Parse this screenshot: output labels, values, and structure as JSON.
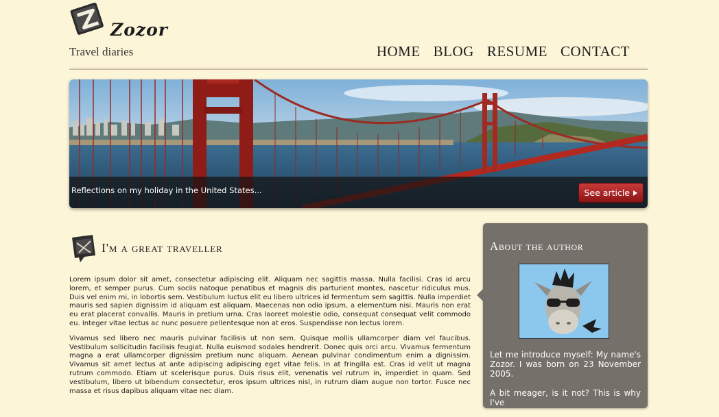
{
  "header": {
    "logo_text": "Zozor",
    "tagline": "Travel diaries",
    "nav": [
      {
        "label": "HOME"
      },
      {
        "label": "BLOG"
      },
      {
        "label": "RESUME"
      },
      {
        "label": "CONTACT"
      }
    ]
  },
  "banner": {
    "caption": "Reflections on my holiday in the United States...",
    "button_label": "See article",
    "button_icon": "triangle-right-icon"
  },
  "article": {
    "icon": "envelope-icon",
    "title": "I'm a great traveller",
    "paragraphs": [
      "Lorem ipsum dolor sit amet, consectetur adipiscing elit. Aliquam nec sagittis massa. Nulla facilisi. Cras id arcu lorem, et semper purus. Cum sociis natoque penatibus et magnis dis parturient montes, nascetur ridiculus mus. Duis vel enim mi, in lobortis sem. Vestibulum luctus elit eu libero ultrices id fermentum sem sagittis. Nulla imperdiet mauris sed sapien dignissim id aliquam est aliquam. Maecenas non odio ipsum, a elementum nisi. Mauris non erat eu erat placerat convallis. Mauris in pretium urna. Cras laoreet molestie odio, consequat consequat velit commodo eu. Integer vitae lectus ac nunc posuere pellentesque non at eros. Suspendisse non lectus lorem.",
      "Vivamus sed libero nec mauris pulvinar facilisis ut non sem. Quisque mollis ullamcorper diam vel faucibus. Vestibulum sollicitudin facilisis feugiat. Nulla euismod sodales hendrerit. Donec quis orci arcu. Vivamus fermentum magna a erat ullamcorper dignissim pretium nunc aliquam. Aenean pulvinar condimentum enim a dignissim. Vivamus sit amet lectus at ante adipiscing adipiscing eget vitae felis. In at fringilla est. Cras id velit ut magna rutrum commodo. Etiam ut scelerisque purus. Duis risus elit, venenatis vel rutrum in, imperdiet in quam. Sed vestibulum, libero ut bibendum consectetur, eros ipsum ultrices nisl, in rutrum diam augue non tortor. Fusce nec massa et risus dapibus aliquam vitae nec diam."
    ]
  },
  "sidebar": {
    "title": "About the author",
    "paragraphs": [
      "Let me introduce myself: My name's Zozor. I was born on 23 November 2005.",
      "A bit meager, is it not? This is why I've"
    ]
  },
  "colors": {
    "background": "#fdf5d8",
    "sidebar_bg": "#757069",
    "button_red": "#b52a2a"
  }
}
